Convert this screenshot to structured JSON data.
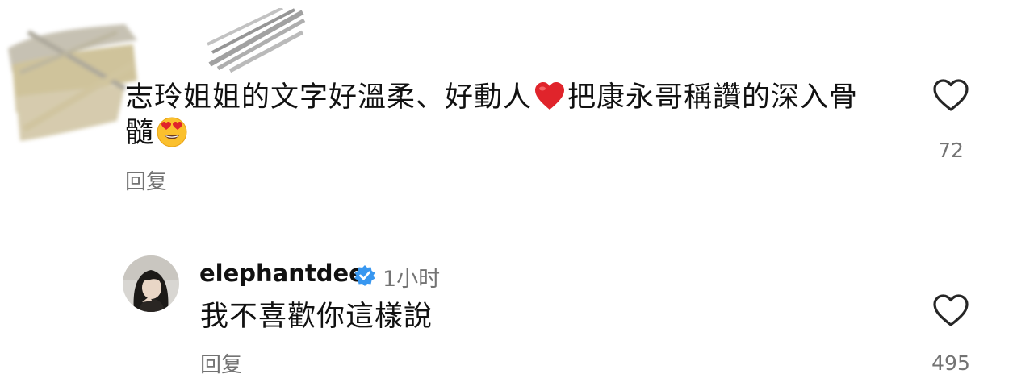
{
  "comment1": {
    "line1_a": "志玲姐姐的文字好溫柔、好動人",
    "line1_b": "把康永哥稱讚的深入骨",
    "line2": "髓",
    "reply_label": "回复",
    "like_count": "72"
  },
  "comment2": {
    "username": "elephantdee",
    "time": "1小时",
    "text": "我不喜歡你這樣說",
    "reply_label": "回复",
    "like_count": "495"
  },
  "icons": {
    "heart_emoji": "red-heart-emoji",
    "heart_eyes_emoji": "smiling-face-with-heart-eyes-emoji",
    "like": "heart-outline-icon",
    "verified": "verified-badge-icon"
  },
  "colors": {
    "verified": "#3897f0",
    "muted": "#737373",
    "heart": "#e0242b"
  }
}
